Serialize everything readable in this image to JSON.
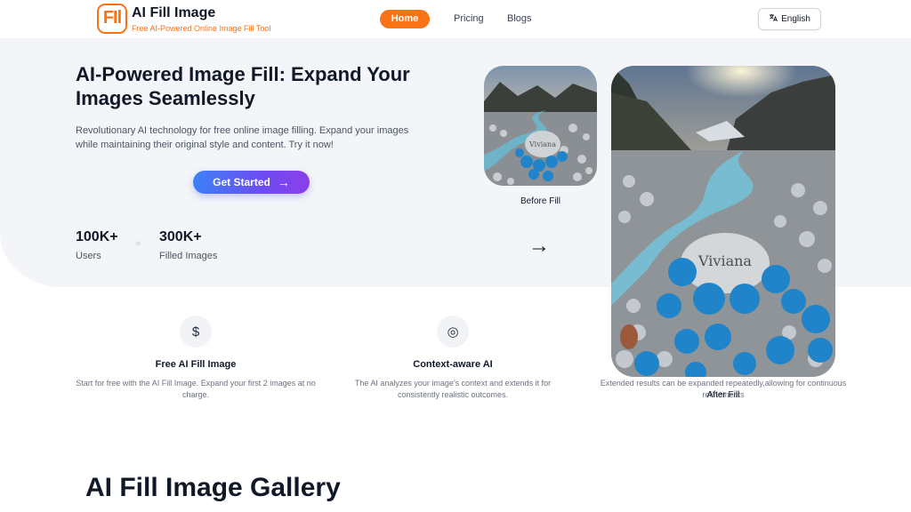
{
  "header": {
    "logo_mark": "FIl",
    "brand_name": "AI Fill Image",
    "tagline": "Free AI-Powered Online Image Fill Tool",
    "nav": {
      "home": "Home",
      "pricing": "Pricing",
      "blogs": "Blogs"
    },
    "language": "English",
    "language_icon": "translate-icon"
  },
  "hero": {
    "title": "AI-Powered Image Fill: Expand Your Images Seamlessly",
    "description": "Revolutionary AI technology for free online image filling. Expand your images while maintaining their original style and content. Try it now!",
    "cta_label": "Get Started",
    "cta_arrow": "→",
    "stats": [
      {
        "value": "100K+",
        "label": "Users"
      },
      {
        "value": "300K+",
        "label": "Filled Images"
      }
    ],
    "stat_separator": "»"
  },
  "comparison": {
    "before_caption": "Before Fill",
    "after_caption": "After Fill",
    "arrow": "→",
    "stone_text": "Viviana"
  },
  "features": [
    {
      "icon": "dollar-icon",
      "glyph": "$",
      "title": "Free AI Fill Image",
      "description": "Start for free with the AI Fill Image. Expand your first 2 images at no charge."
    },
    {
      "icon": "brain-icon",
      "glyph": "◎",
      "title": "Context-aware AI",
      "description": "The AI analyzes your image's context and extends it for consistently realistic outcomes."
    },
    {
      "icon": "",
      "glyph": "",
      "title": "",
      "description": "Extended results can be expanded repeatedly,allowing for continuous refinements"
    }
  ],
  "gallery": {
    "title": "AI Fill Image Gallery"
  },
  "colors": {
    "accent": "#f97316",
    "cta_gradient_start": "#3b82f6",
    "cta_gradient_end": "#8b3fe8",
    "hero_bg": "#f3f5f8",
    "rose": "#1f84c9"
  }
}
